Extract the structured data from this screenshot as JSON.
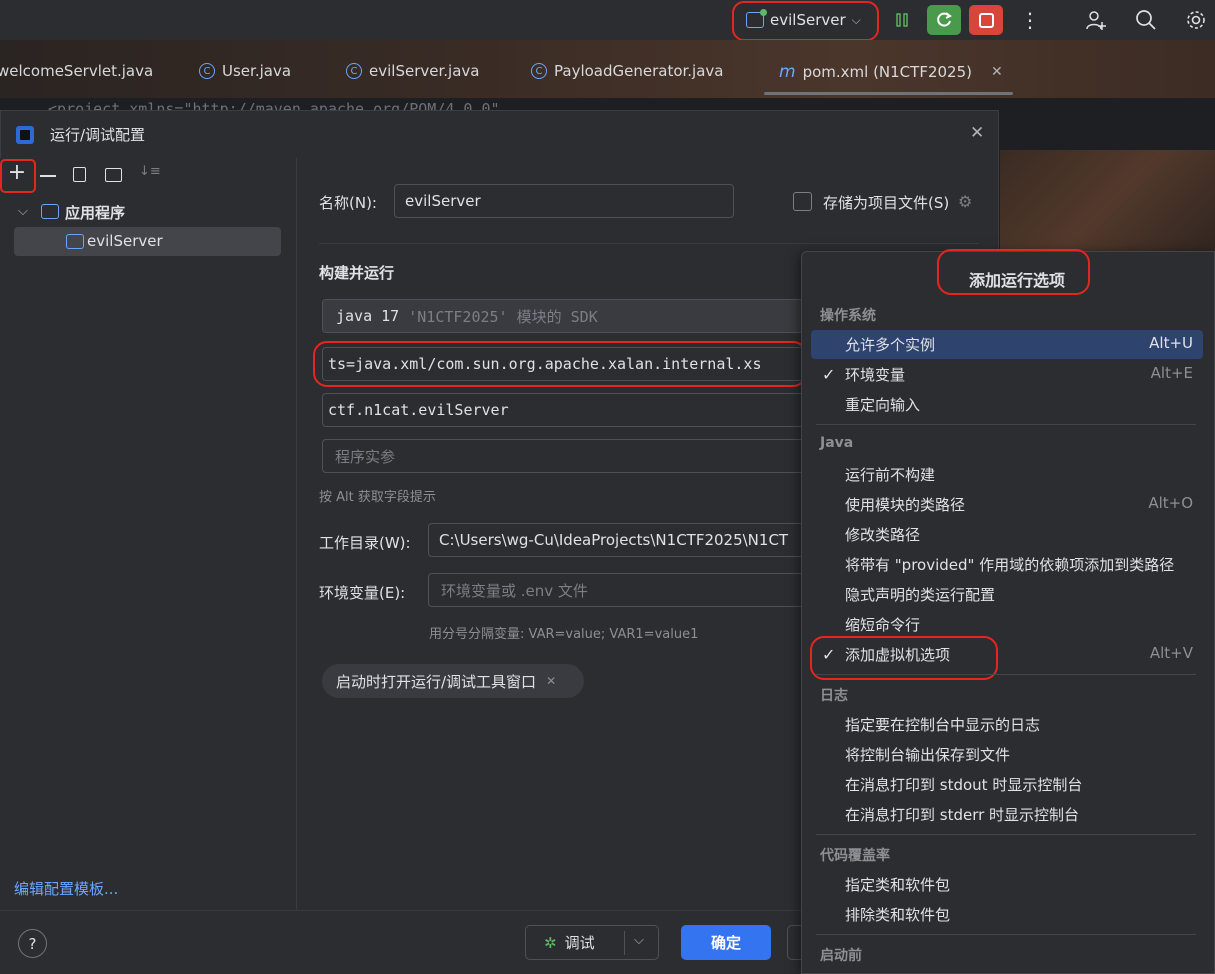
{
  "toolbar": {
    "run_config_name": "evilServer",
    "icons": [
      "run-config-icon",
      "pause-icon",
      "rerun-icon",
      "stop-icon",
      "more-icon",
      "add-user-icon",
      "search-icon",
      "settings-icon"
    ]
  },
  "tabs": [
    {
      "label": "welcomeServlet.java",
      "icon": "class-icon"
    },
    {
      "label": "User.java",
      "icon": "class-icon"
    },
    {
      "label": "evilServer.java",
      "icon": "class-run-icon"
    },
    {
      "label": "PayloadGenerator.java",
      "icon": "class-icon"
    },
    {
      "label": "pom.xml (N1CTF2025)",
      "icon": "maven-icon",
      "prefix": "m",
      "active": true
    }
  ],
  "editor": {
    "partial_line": "<project xmlns=\"http://maven.apache.org/POM/4.0.0\""
  },
  "dialog": {
    "title": "运行/调试配置",
    "tree": {
      "group": "应用程序",
      "selected_item": "evilServer"
    },
    "edit_templates_link": "编辑配置模板...",
    "name_label": "名称(N):",
    "name_label_mnemonic": "N",
    "name_value": "evilServer",
    "store_as_project_file": "存储为项目文件(S)",
    "section_title": "构建并运行",
    "sdk_prefix": "java 17",
    "sdk_hint": " 'N1CTF2025' 模块的 SDK",
    "vm_options_value": "ts=java.xml/com.sun.org.apache.xalan.internal.xs",
    "main_class_value": "ctf.n1cat.evilServer",
    "program_args_placeholder": "程序实参",
    "alt_hint": "按 Alt 获取字段提示",
    "workdir_label": "工作目录(W):",
    "workdir_value": "C:\\Users\\wg-Cu\\IdeaProjects\\N1CTF2025\\N1CT",
    "env_label": "环境变量(E):",
    "env_placeholder": "环境变量或 .env 文件",
    "env_hint": "用分号分隔变量: VAR=value; VAR1=value1",
    "chip_label": "启动时打开运行/调试工具窗口",
    "help_label": "?",
    "debug_label": "调试",
    "ok_label": "确定"
  },
  "popup": {
    "title": "添加运行选项",
    "sections": [
      {
        "title": "操作系统",
        "items": [
          {
            "label": "允许多个实例",
            "shortcut": "Alt+U",
            "checked": false,
            "highlighted": true
          },
          {
            "label": "环境变量",
            "shortcut": "Alt+E",
            "checked": true
          },
          {
            "label": "重定向输入",
            "shortcut": "",
            "checked": false
          }
        ]
      },
      {
        "title": "Java",
        "items": [
          {
            "label": "运行前不构建",
            "shortcut": "",
            "checked": false
          },
          {
            "label": "使用模块的类路径",
            "shortcut": "Alt+O",
            "checked": false
          },
          {
            "label": "修改类路径",
            "shortcut": "",
            "checked": false
          },
          {
            "label": "将带有 \"provided\" 作用域的依赖项添加到类路径",
            "shortcut": "",
            "checked": false
          },
          {
            "label": "隐式声明的类运行配置",
            "shortcut": "",
            "checked": false
          },
          {
            "label": "缩短命令行",
            "shortcut": "",
            "checked": false
          },
          {
            "label": "添加虚拟机选项",
            "shortcut": "Alt+V",
            "checked": true
          }
        ]
      },
      {
        "title": "日志",
        "items": [
          {
            "label": "指定要在控制台中显示的日志",
            "shortcut": "",
            "checked": false
          },
          {
            "label": "将控制台输出保存到文件",
            "shortcut": "",
            "checked": false
          },
          {
            "label": "在消息打印到 stdout 时显示控制台",
            "shortcut": "",
            "checked": false
          },
          {
            "label": "在消息打印到 stderr 时显示控制台",
            "shortcut": "",
            "checked": false
          }
        ]
      },
      {
        "title": "代码覆盖率",
        "items": [
          {
            "label": "指定类和软件包",
            "shortcut": "",
            "checked": false
          },
          {
            "label": "排除类和软件包",
            "shortcut": "",
            "checked": false
          }
        ]
      },
      {
        "title": "启动前",
        "items": []
      }
    ]
  },
  "colors": {
    "accent": "#3574f0",
    "highlight_row": "#2e436e",
    "annotation": "#e5261f",
    "rerun_green": "#4a9a4e",
    "stop_red": "#d9453b"
  }
}
